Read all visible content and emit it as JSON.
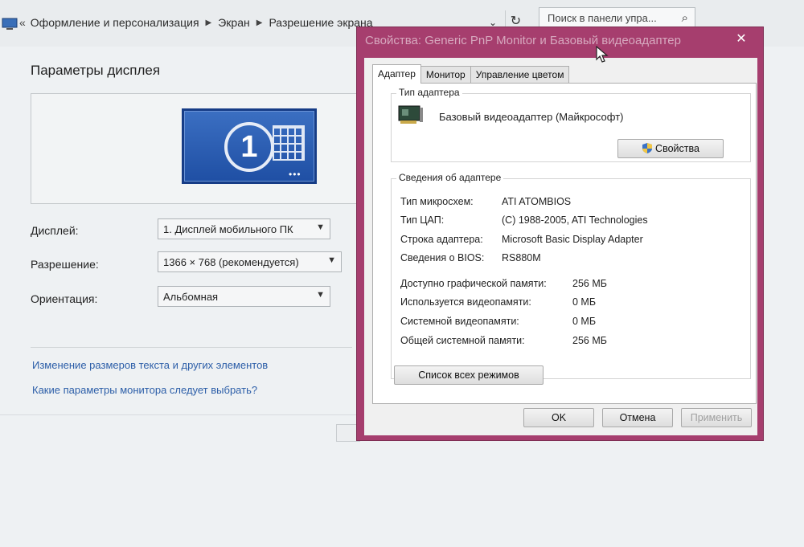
{
  "address_bar": {
    "breadcrumbs": [
      "Оформление и персонализация",
      "Экран",
      "Разрешение экрана"
    ],
    "search_placeholder": "Поиск в панели упра..."
  },
  "display_settings": {
    "title": "Параметры дисплея",
    "monitor_number": "1",
    "fields": [
      {
        "label": "Дисплей:",
        "value": "1. Дисплей мобильного ПК"
      },
      {
        "label": "Разрешение:",
        "value": "1366 × 768 (рекомендуется)"
      },
      {
        "label": "Ориентация:",
        "value": "Альбомная"
      }
    ],
    "links": [
      "Изменение размеров текста и других элементов",
      "Какие параметры монитора следует выбрать?"
    ]
  },
  "dialog": {
    "title": "Свойства: Generic PnP Monitor и Базовый видеоадаптер",
    "tabs": [
      "Адаптер",
      "Монитор",
      "Управление цветом"
    ],
    "active_tab": "Адаптер",
    "adapter_type_group": "Тип адаптера",
    "adapter_name": "Базовый видеоадаптер (Майкрософт)",
    "properties_button": "Свойства",
    "info_group": "Сведения об адаптере",
    "info_rows": [
      {
        "label": "Тип микросхем:",
        "value": "ATI ATOMBIOS"
      },
      {
        "label": "Тип ЦАП:",
        "value": "(C) 1988-2005, ATI Technologies"
      },
      {
        "label": "Строка адаптера:",
        "value": "Microsoft Basic Display Adapter"
      },
      {
        "label": "Сведения о BIOS:",
        "value": "RS880M"
      }
    ],
    "memory_rows": [
      {
        "label": "Доступно графической памяти:",
        "value": "256 МБ"
      },
      {
        "label": "Используется видеопамяти:",
        "value": "0 МБ"
      },
      {
        "label": "Системной видеопамяти:",
        "value": "0 МБ"
      },
      {
        "label": "Общей системной памяти:",
        "value": "256 МБ"
      }
    ],
    "list_modes_button": "Список всех режимов",
    "ok_button": "OK",
    "cancel_button": "Отмена",
    "apply_button": "Применить"
  },
  "colors": {
    "dialog_frame": "#a63e6e",
    "link": "#2c5ea8",
    "monitor_tile": "#2a5bb3"
  }
}
